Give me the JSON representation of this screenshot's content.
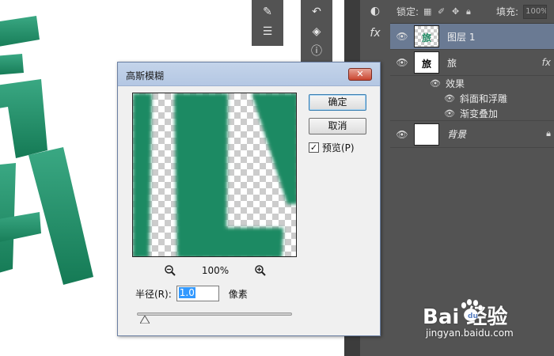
{
  "dialog": {
    "title": "高斯模糊",
    "close_label": "✕",
    "ok_label": "确定",
    "cancel_label": "取消",
    "preview_label": "预览(P)",
    "preview_checked": true,
    "zoom_level": "100%",
    "radius_label": "半径(R):",
    "radius_value": "1.0",
    "unit_label": "像素"
  },
  "layers_panel": {
    "lock_label": "锁定:",
    "fill_label": "填充:",
    "fill_value": "100%",
    "layers": [
      {
        "name": "图层 1",
        "selected": true,
        "thumb": "旅"
      },
      {
        "name": "旅",
        "selected": false,
        "thumb": "旅",
        "fx": "fx"
      },
      {
        "name": "背景",
        "selected": false,
        "locked": true
      }
    ],
    "effects_label": "效果",
    "effects": [
      "斜面和浮雕",
      "渐变叠加"
    ]
  },
  "watermark": {
    "brand": "Bai  经验",
    "url": "jingyan.baidu.com"
  },
  "colors": {
    "panel_bg": "#535353",
    "selected_layer": "#6a7a93",
    "text_green": "#1f8a63",
    "dialog_bg": "#f0f0f0"
  }
}
